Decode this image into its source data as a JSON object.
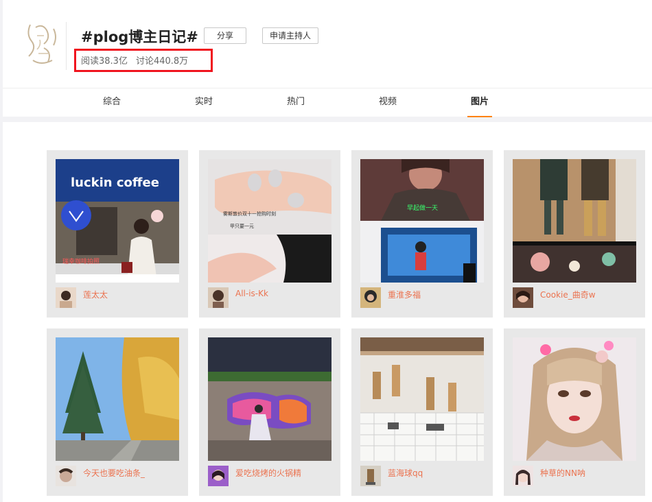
{
  "topic": {
    "title": "#plog博主日记#",
    "share_label": "分享",
    "host_label": "申请主持人",
    "reads": "阅读38.3亿",
    "discussions": "讨论440.8万"
  },
  "tabs": [
    {
      "label": "综合"
    },
    {
      "label": "实时"
    },
    {
      "label": "热门"
    },
    {
      "label": "视频"
    },
    {
      "label": "图片",
      "active": true
    }
  ],
  "posts": [
    {
      "username": "莲太太",
      "photo_text": "luckin coffee",
      "photo_caption": "瑞幸咖啡拍照"
    },
    {
      "username": "All-is-Kk",
      "photo_text": "雾斯敦价双十一抢购时刻",
      "photo_caption": "甲只要一元"
    },
    {
      "username": "重淮多福",
      "photo_text": "早起做一天"
    },
    {
      "username": "Cookie_曲奇w"
    },
    {
      "username": "今天也要吃油条_"
    },
    {
      "username": "爱吃烧烤的火锅精"
    },
    {
      "username": "蓝海球qq"
    },
    {
      "username": "种草的NN呐"
    }
  ],
  "colors": {
    "accent": "#ff8200",
    "username": "#eb7350",
    "highlight": "#f0141e"
  }
}
